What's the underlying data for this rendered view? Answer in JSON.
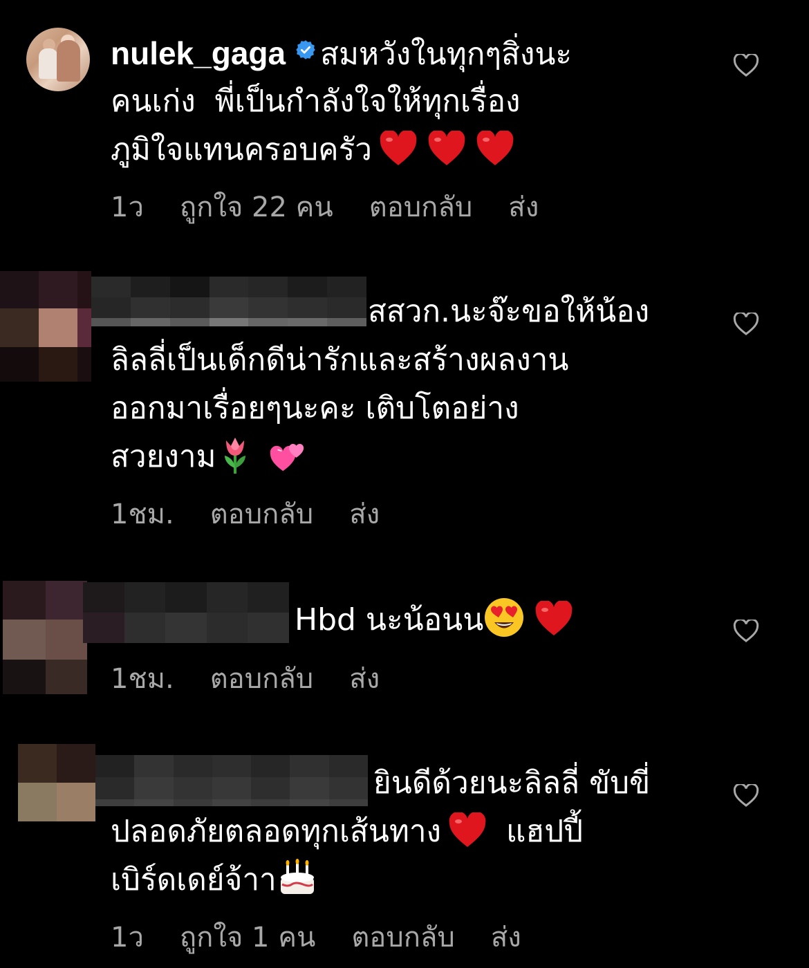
{
  "comments": [
    {
      "username": "nulek_gaga",
      "verified": true,
      "lines": [
        "สมหวังในทุกๆสิ่งนะ",
        "คนเก่ง  พี่เป็นกำลังใจให้ทุกเรื่อง",
        "ภูมิใจแทนครอบครัว"
      ],
      "emoji": [
        "red-heart",
        "red-heart",
        "red-heart"
      ],
      "time": "1ว",
      "likes": "ถูกใจ 22 คน",
      "reply": "ตอบกลับ",
      "send": "ส่ง"
    },
    {
      "username_blurred": true,
      "lines": [
        "สสวก.นะจ๊ะขอให้น้อง",
        "ลิลลี่เป็นเด็กดีน่ารักและสร้างผลงาน",
        "ออกมาเรื่อยๆนะคะ เติบโตอย่าง",
        "สวยงาม"
      ],
      "emoji": [
        "tulip",
        "two-hearts"
      ],
      "time": "1ชม.",
      "reply": "ตอบกลับ",
      "send": "ส่ง"
    },
    {
      "username_blurred": true,
      "lines": [
        "Hbd นะน้อนน"
      ],
      "emoji": [
        "heart-eyes",
        "red-heart"
      ],
      "time": "1ชม.",
      "reply": "ตอบกลับ",
      "send": "ส่ง"
    },
    {
      "username_blurred": true,
      "lines": [
        "ยินดีด้วยนะลิลลี่ ขับขี่",
        "ปลอดภัยตลอดทุกเส้นทาง",
        "เบิร์ดเดย์จ้าา"
      ],
      "line2_suffix": " แฮปปี้",
      "emoji": [
        "red-heart",
        "birthday-cake"
      ],
      "time": "1ว",
      "likes": "ถูกใจ 1 คน",
      "reply": "ตอบกลับ",
      "send": "ส่ง"
    }
  ],
  "colors": {
    "background": "#000000",
    "text": "#ffffff",
    "meta": "#a8a8a8",
    "verified": "#3897f0",
    "heart_emoji": "#e0161e"
  },
  "icons": {
    "like": "heart-outline-icon",
    "verified": "verified-badge-icon"
  }
}
